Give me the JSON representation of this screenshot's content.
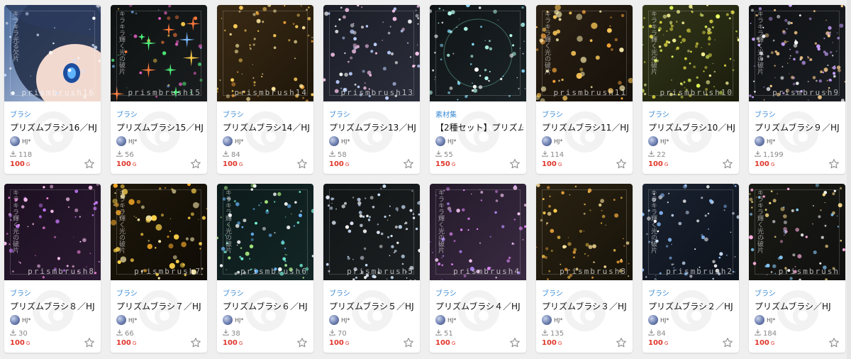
{
  "colors": {
    "accent": "#3b8bd4",
    "price": "#e0372c"
  },
  "cards": [
    {
      "category": "ブラシ",
      "title": "プリズムブラシ16／HJ",
      "author": "HJ*",
      "downloads": "118",
      "price": "100",
      "unit": "G",
      "brand": "prismbrush16",
      "vtext": "キラキラ光る欠片",
      "thumb": "anime"
    },
    {
      "category": "ブラシ",
      "title": "プリズムブラシ15／HJ",
      "author": "HJ*",
      "downloads": "56",
      "price": "100",
      "unit": "G",
      "brand": "prismbrush15",
      "vtext": "キラキラ輝く光の破片",
      "thumb": "star"
    },
    {
      "category": "ブラシ",
      "title": "プリズムブラシ14／HJ",
      "author": "HJ*",
      "downloads": "84",
      "price": "100",
      "unit": "G",
      "brand": "prismbrush14",
      "vtext": "",
      "thumb": "gold"
    },
    {
      "category": "ブラシ",
      "title": "プリズムブラシ13／HJ",
      "author": "HJ*",
      "downloads": "58",
      "price": "100",
      "unit": "G",
      "brand": "prismbrush13",
      "vtext": "",
      "thumb": "silver"
    },
    {
      "category": "素材集",
      "title": "【2種セット】プリズム",
      "author": "HJ*",
      "downloads": "55",
      "price": "150",
      "unit": "G",
      "brand": "",
      "vtext": "",
      "thumb": "set"
    },
    {
      "category": "ブラシ",
      "title": "プリズムブラシ11／HJ",
      "author": "HJ*",
      "downloads": "114",
      "price": "100",
      "unit": "G",
      "brand": "prismbrush11",
      "vtext": "キラキラ輝く光の破片",
      "thumb": "bokeh"
    },
    {
      "category": "ブラシ",
      "title": "プリズムブラシ10／HJ",
      "author": "HJ*",
      "downloads": "22",
      "price": "100",
      "unit": "G",
      "brand": "prismbrush10",
      "vtext": "キラキラ輝く光の破片",
      "thumb": "yellow"
    },
    {
      "category": "ブラシ",
      "title": "プリズムブラシ９／HJ",
      "author": "HJ*",
      "downloads": "1,199",
      "price": "100",
      "unit": "G",
      "brand": "prismbrush9",
      "vtext": "キラキラ輝く光の破片",
      "thumb": "dust"
    },
    {
      "category": "ブラシ",
      "title": "プリズムブラシ８／HJ",
      "author": "HJ*",
      "downloads": "30",
      "price": "100",
      "unit": "G",
      "brand": "prismbrush8",
      "vtext": "キラキラ輝く光の破片",
      "thumb": "pink"
    },
    {
      "category": "ブラシ",
      "title": "プリズムブラシ７／HJ",
      "author": "HJ*",
      "downloads": "66",
      "price": "100",
      "unit": "G",
      "brand": "prismbrush7",
      "vtext": "キラキラ輝く光の破片",
      "thumb": "goldbokeh"
    },
    {
      "category": "ブラシ",
      "title": "プリズムブラシ６／HJ",
      "author": "HJ*",
      "downloads": "38",
      "price": "100",
      "unit": "G",
      "brand": "prismbrush6",
      "vtext": "キラキラ輝く光の破片",
      "thumb": "teal"
    },
    {
      "category": "ブラシ",
      "title": "プリズムブラシ５／HJ",
      "author": "HJ*",
      "downloads": "70",
      "price": "100",
      "unit": "G",
      "brand": "prismbrush5",
      "vtext": "",
      "thumb": "white"
    },
    {
      "category": "ブラシ",
      "title": "プリズムブラシ４／HJ",
      "author": "HJ*",
      "downloads": "51",
      "price": "100",
      "unit": "G",
      "brand": "prismbrush4",
      "vtext": "キラキラ輝く光の破片",
      "thumb": "violet"
    },
    {
      "category": "ブラシ",
      "title": "プリズムブラシ３／HJ",
      "author": "HJ*",
      "downloads": "135",
      "price": "100",
      "unit": "G",
      "brand": "prismbrush3",
      "vtext": "",
      "thumb": "amber"
    },
    {
      "category": "ブラシ",
      "title": "プリズムブラシ２／HJ",
      "author": "HJ*",
      "downloads": "84",
      "price": "100",
      "unit": "G",
      "brand": "prismbrush2",
      "vtext": "キラキラ輝く光の破片",
      "thumb": "shard"
    },
    {
      "category": "ブラシ",
      "title": "プリズムブラシ／HJ",
      "author": "HJ*",
      "downloads": "184",
      "price": "100",
      "unit": "G",
      "brand": "prismbrush",
      "vtext": "キラキラ輝く光の破片",
      "thumb": "mixed"
    }
  ]
}
